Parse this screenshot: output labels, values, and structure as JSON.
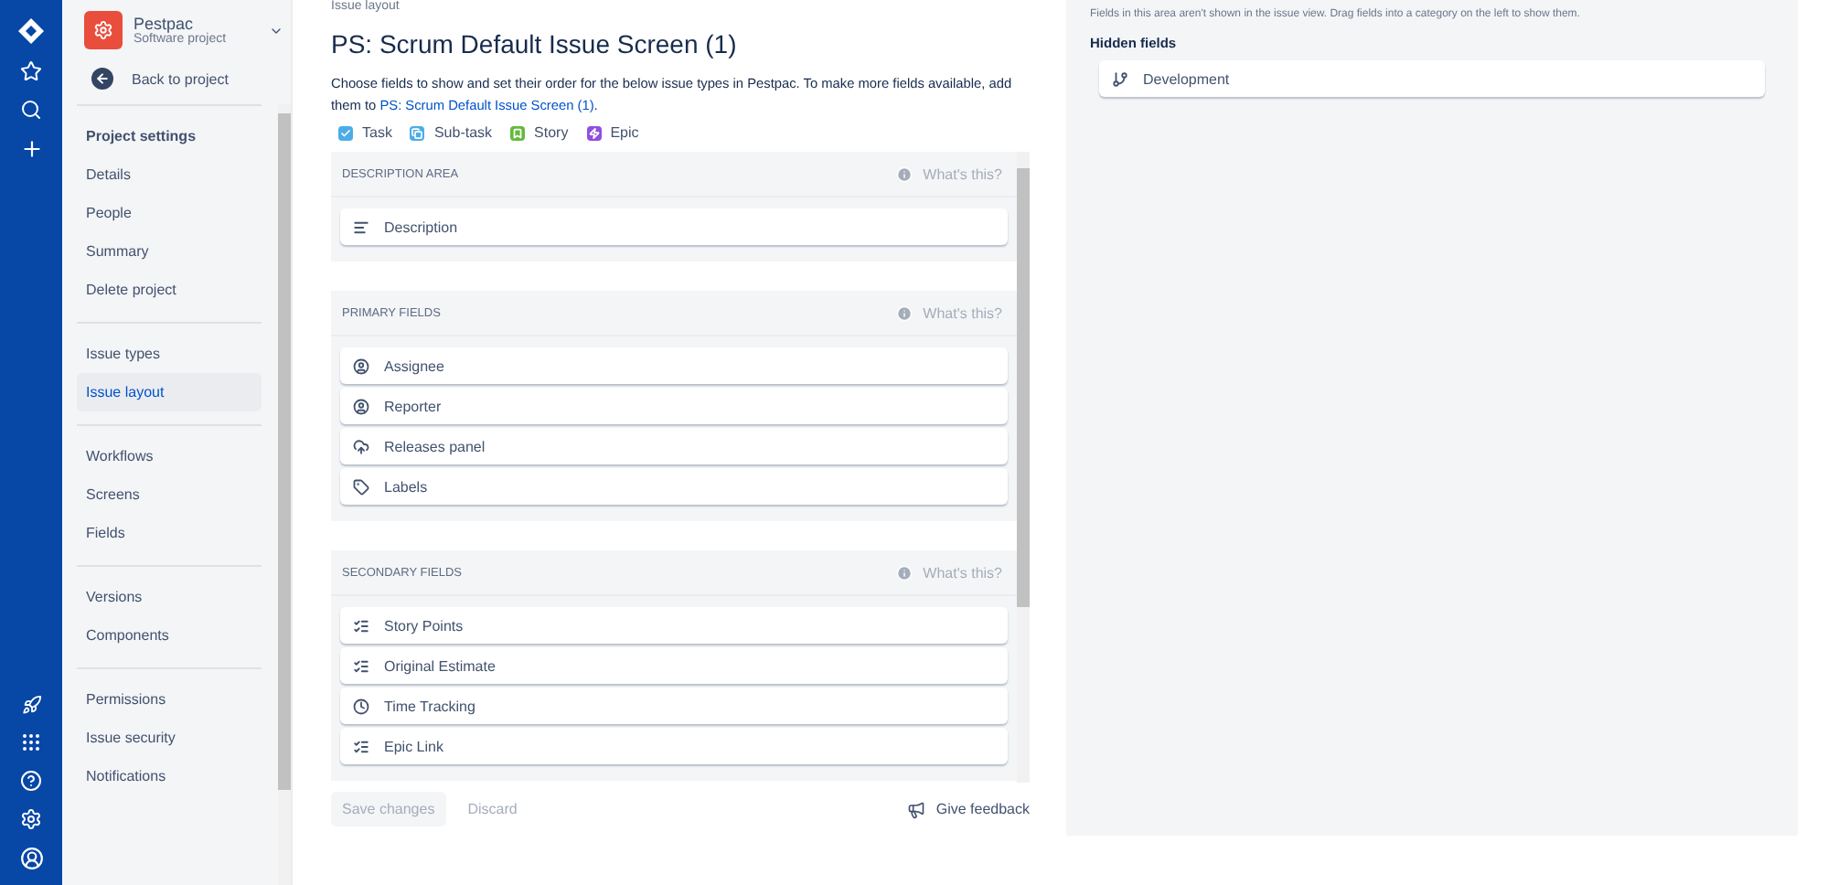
{
  "project": {
    "name": "Pestpac",
    "type": "Software project"
  },
  "back_link": "Back to project",
  "sidebar": {
    "groups": [
      {
        "heading": "Project settings",
        "items": [
          {
            "label": "Details",
            "selected": false
          },
          {
            "label": "People",
            "selected": false
          },
          {
            "label": "Summary",
            "selected": false
          },
          {
            "label": "Delete project",
            "selected": false
          }
        ]
      },
      {
        "items": [
          {
            "label": "Issue types",
            "selected": false
          },
          {
            "label": "Issue layout",
            "selected": true
          }
        ]
      },
      {
        "items": [
          {
            "label": "Workflows",
            "selected": false
          },
          {
            "label": "Screens",
            "selected": false
          },
          {
            "label": "Fields",
            "selected": false
          }
        ]
      },
      {
        "items": [
          {
            "label": "Versions",
            "selected": false
          },
          {
            "label": "Components",
            "selected": false
          }
        ]
      },
      {
        "items": [
          {
            "label": "Permissions",
            "selected": false
          },
          {
            "label": "Issue security",
            "selected": false
          },
          {
            "label": "Notifications",
            "selected": false
          }
        ]
      }
    ]
  },
  "breadcrumb": "Issue layout",
  "title": "PS: Scrum Default Issue Screen (1)",
  "intro": {
    "text": "Choose fields to show and set their order for the below issue types in Pestpac. To make more fields available, add them to",
    "link": "PS: Scrum Default Issue Screen (1)",
    "after": "."
  },
  "issue_types": [
    {
      "label": "Task",
      "color": "#4bade8",
      "kind": "check"
    },
    {
      "label": "Sub-task",
      "color": "#4bade8",
      "kind": "subtask"
    },
    {
      "label": "Story",
      "color": "#63ba3c",
      "kind": "story"
    },
    {
      "label": "Epic",
      "color": "#904ee2",
      "kind": "epic"
    }
  ],
  "sections": [
    {
      "heading": "DESCRIPTION AREA",
      "help": "What's this?",
      "fields": [
        {
          "label": "Description",
          "kind": "lines"
        }
      ]
    },
    {
      "heading": "PRIMARY FIELDS",
      "help": "What's this?",
      "fields": [
        {
          "label": "Assignee",
          "kind": "person"
        },
        {
          "label": "Reporter",
          "kind": "person"
        },
        {
          "label": "Releases panel",
          "kind": "cloud"
        },
        {
          "label": "Labels",
          "kind": "tag"
        }
      ]
    },
    {
      "heading": "SECONDARY FIELDS",
      "help": "What's this?",
      "fields": [
        {
          "label": "Story Points",
          "kind": "list"
        },
        {
          "label": "Original Estimate",
          "kind": "list"
        },
        {
          "label": "Time Tracking",
          "kind": "clock"
        },
        {
          "label": "Epic Link",
          "kind": "list"
        }
      ]
    }
  ],
  "footer": {
    "save": "Save changes",
    "discard": "Discard",
    "feedback": "Give feedback"
  },
  "hidden_panel": {
    "note": "Fields in this area aren't shown in the issue view. Drag fields into a category on the left to show them.",
    "heading": "Hidden fields",
    "fields": [
      {
        "label": "Development",
        "kind": "branch"
      }
    ]
  }
}
